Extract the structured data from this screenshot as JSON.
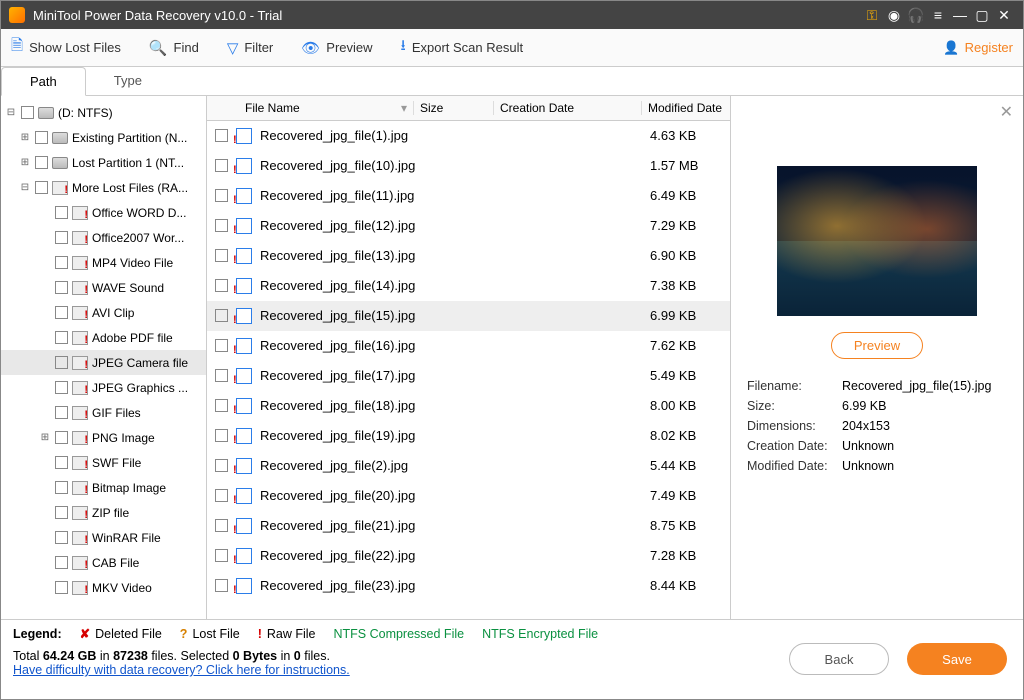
{
  "titlebar": {
    "title": "MiniTool Power Data Recovery v10.0 - Trial"
  },
  "toolbar": {
    "show_lost": "Show Lost Files",
    "find": "Find",
    "filter": "Filter",
    "preview": "Preview",
    "export": "Export Scan Result",
    "register": "Register"
  },
  "tabs": {
    "path": "Path",
    "type": "Type"
  },
  "tree": {
    "root": "(D: NTFS)",
    "existing": "Existing Partition (N...",
    "lost": "Lost Partition 1 (NT...",
    "more_lost": "More Lost Files (RA...",
    "items": [
      "Office WORD D...",
      "Office2007 Wor...",
      "MP4 Video File",
      "WAVE Sound",
      "AVI Clip",
      "Adobe PDF file",
      "JPEG Camera file",
      "JPEG Graphics ...",
      "GIF Files",
      "PNG Image",
      "SWF File",
      "Bitmap Image",
      "ZIP file",
      "WinRAR File",
      "CAB File",
      "MKV Video"
    ],
    "selected_index": 6
  },
  "columns": {
    "name": "File Name",
    "size": "Size",
    "created": "Creation Date",
    "modified": "Modified Date"
  },
  "files": [
    {
      "name": "Recovered_jpg_file(1).jpg",
      "size": "4.63 KB"
    },
    {
      "name": "Recovered_jpg_file(10).jpg",
      "size": "1.57 MB"
    },
    {
      "name": "Recovered_jpg_file(11).jpg",
      "size": "6.49 KB"
    },
    {
      "name": "Recovered_jpg_file(12).jpg",
      "size": "7.29 KB"
    },
    {
      "name": "Recovered_jpg_file(13).jpg",
      "size": "6.90 KB"
    },
    {
      "name": "Recovered_jpg_file(14).jpg",
      "size": "7.38 KB"
    },
    {
      "name": "Recovered_jpg_file(15).jpg",
      "size": "6.99 KB"
    },
    {
      "name": "Recovered_jpg_file(16).jpg",
      "size": "7.62 KB"
    },
    {
      "name": "Recovered_jpg_file(17).jpg",
      "size": "5.49 KB"
    },
    {
      "name": "Recovered_jpg_file(18).jpg",
      "size": "8.00 KB"
    },
    {
      "name": "Recovered_jpg_file(19).jpg",
      "size": "8.02 KB"
    },
    {
      "name": "Recovered_jpg_file(2).jpg",
      "size": "5.44 KB"
    },
    {
      "name": "Recovered_jpg_file(20).jpg",
      "size": "7.49 KB"
    },
    {
      "name": "Recovered_jpg_file(21).jpg",
      "size": "8.75 KB"
    },
    {
      "name": "Recovered_jpg_file(22).jpg",
      "size": "7.28 KB"
    },
    {
      "name": "Recovered_jpg_file(23).jpg",
      "size": "8.44 KB"
    }
  ],
  "selected_file_index": 6,
  "preview": {
    "btn": "Preview",
    "filename_k": "Filename:",
    "filename_v": "Recovered_jpg_file(15).jpg",
    "size_k": "Size:",
    "size_v": "6.99 KB",
    "dim_k": "Dimensions:",
    "dim_v": "204x153",
    "created_k": "Creation Date:",
    "created_v": "Unknown",
    "modified_k": "Modified Date:",
    "modified_v": "Unknown"
  },
  "legend": {
    "label": "Legend:",
    "deleted": "Deleted File",
    "lost": "Lost File",
    "raw": "Raw File",
    "ntfs_c": "NTFS Compressed File",
    "ntfs_e": "NTFS Encrypted File"
  },
  "status": {
    "total_pre": "Total ",
    "total_gb": "64.24 GB",
    "total_mid": " in ",
    "total_files": "87238",
    "total_post": " files.   Selected ",
    "sel_bytes": "0 Bytes",
    "sel_mid": " in ",
    "sel_files": "0",
    "sel_post": " files."
  },
  "help_link": "Have difficulty with data recovery? Click here for instructions.",
  "buttons": {
    "back": "Back",
    "save": "Save"
  }
}
